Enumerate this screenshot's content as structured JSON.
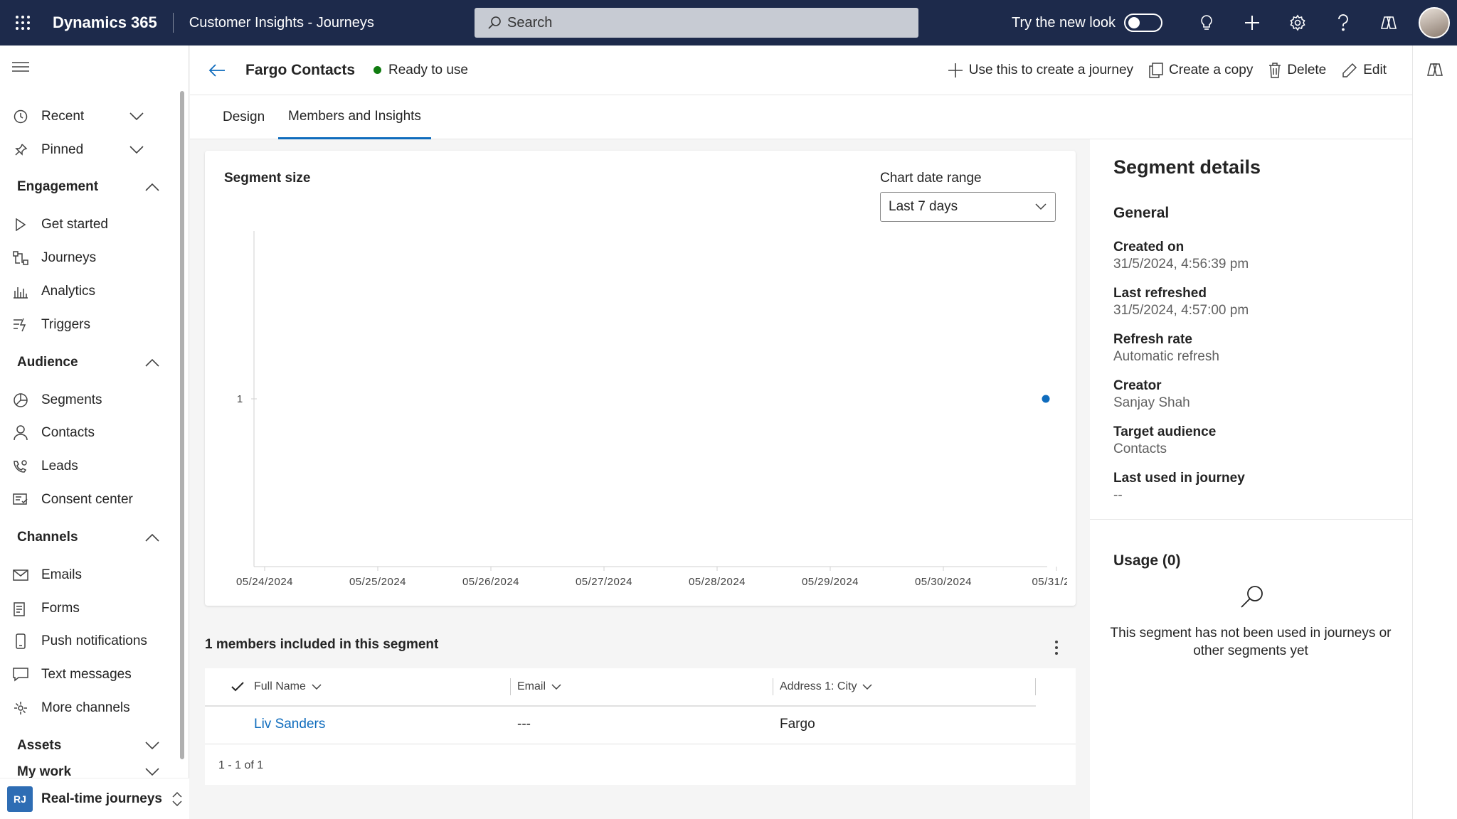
{
  "topbar": {
    "app_name": "Dynamics 365",
    "app_area": "Customer Insights - Journeys",
    "search_placeholder": "Search",
    "new_look_label": "Try the new look",
    "icons": [
      "waffle-icon",
      "lightbulb-icon",
      "plus-icon",
      "gear-icon",
      "help-icon",
      "copilot-icon"
    ]
  },
  "sidebar": {
    "recent": "Recent",
    "pinned": "Pinned",
    "engagement": {
      "header": "Engagement",
      "items": [
        "Get started",
        "Journeys",
        "Analytics",
        "Triggers"
      ]
    },
    "audience": {
      "header": "Audience",
      "items": [
        "Segments",
        "Contacts",
        "Leads",
        "Consent center"
      ]
    },
    "channels": {
      "header": "Channels",
      "items": [
        "Emails",
        "Forms",
        "Push notifications",
        "Text messages",
        "More channels"
      ]
    },
    "assets": "Assets",
    "my_work": "My work",
    "area_badge": "RJ",
    "area_label": "Real-time journeys"
  },
  "record": {
    "title": "Fargo Contacts",
    "status": "Ready to use",
    "status_color": "#107c10",
    "commands": {
      "create_journey": "Use this to create a journey",
      "copy": "Create a copy",
      "delete": "Delete",
      "edit": "Edit"
    }
  },
  "tabs": [
    {
      "label": "Design",
      "active": false
    },
    {
      "label": "Members and Insights",
      "active": true
    }
  ],
  "chart_card": {
    "title": "Segment size",
    "range_label": "Chart date range",
    "range_value": "Last 7 days"
  },
  "chart_data": {
    "type": "scatter",
    "title": "Segment size",
    "x_ticks": [
      "05/24/2024",
      "05/25/2024",
      "05/26/2024",
      "05/27/2024",
      "05/28/2024",
      "05/29/2024",
      "05/30/2024",
      "05/31/2…"
    ],
    "y_ticks": [
      "1"
    ],
    "points": [
      {
        "x": "05/31/2024",
        "y": 1
      }
    ],
    "point_color": "#0f6cbd"
  },
  "details": {
    "title": "Segment details",
    "general": "General",
    "fields": [
      {
        "label": "Created on",
        "value": "31/5/2024, 4:56:39 pm"
      },
      {
        "label": "Last refreshed",
        "value": "31/5/2024, 4:57:00 pm"
      },
      {
        "label": "Refresh rate",
        "value": "Automatic refresh"
      },
      {
        "label": "Creator",
        "value": "Sanjay Shah"
      },
      {
        "label": "Target audience",
        "value": "Contacts"
      },
      {
        "label": "Last used in journey",
        "value": "--"
      }
    ],
    "usage_title": "Usage (0)",
    "usage_message": "This segment has not been used in journeys or other segments yet"
  },
  "members": {
    "title": "1 members included in this segment",
    "columns": [
      "Full Name",
      "Email",
      "Address 1: City"
    ],
    "rows": [
      {
        "full_name": "Liv Sanders",
        "email": "---",
        "city": "Fargo"
      }
    ],
    "pager": "1 - 1 of 1"
  }
}
